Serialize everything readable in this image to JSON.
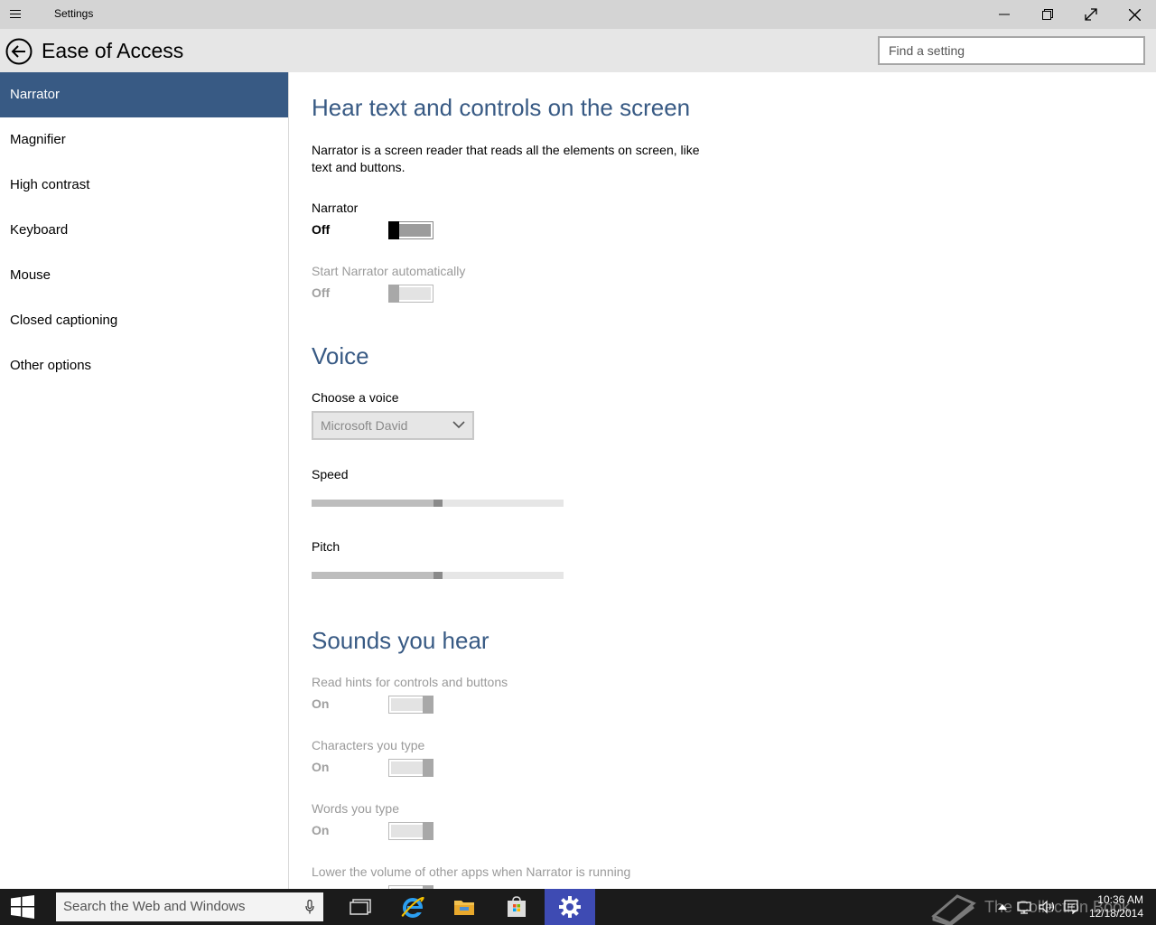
{
  "window": {
    "title": "Settings"
  },
  "header": {
    "page_title": "Ease of Access",
    "search_placeholder": "Find a setting"
  },
  "sidebar": {
    "items": [
      {
        "label": "Narrator",
        "active": true
      },
      {
        "label": "Magnifier"
      },
      {
        "label": "High contrast"
      },
      {
        "label": "Keyboard"
      },
      {
        "label": "Mouse"
      },
      {
        "label": "Closed captioning"
      },
      {
        "label": "Other options"
      }
    ]
  },
  "content": {
    "section1_title": "Hear text and controls on the screen",
    "description": "Narrator is a screen reader that reads all the elements on screen, like text and buttons.",
    "narrator_label": "Narrator",
    "narrator_state": "Off",
    "auto_label": "Start Narrator automatically",
    "auto_state": "Off",
    "voice_title": "Voice",
    "choose_voice_label": "Choose a voice",
    "voice_selected": "Microsoft David",
    "speed_label": "Speed",
    "speed_value": 0.5,
    "pitch_label": "Pitch",
    "pitch_value": 0.5,
    "sounds_title": "Sounds you hear",
    "hints_label": "Read hints for controls and buttons",
    "hints_state": "On",
    "chars_label": "Characters you type",
    "chars_state": "On",
    "words_label": "Words you type",
    "words_state": "On",
    "lower_label": "Lower the volume of other apps when Narrator is running"
  },
  "taskbar": {
    "search_placeholder": "Search the Web and Windows",
    "watermark": "The Collection Book",
    "time": "10:36 AM",
    "date": "12/18/2014"
  },
  "colors": {
    "accent": "#385a84",
    "taskbar": "#1b1b1b",
    "active_app": "#3e4bb3"
  }
}
